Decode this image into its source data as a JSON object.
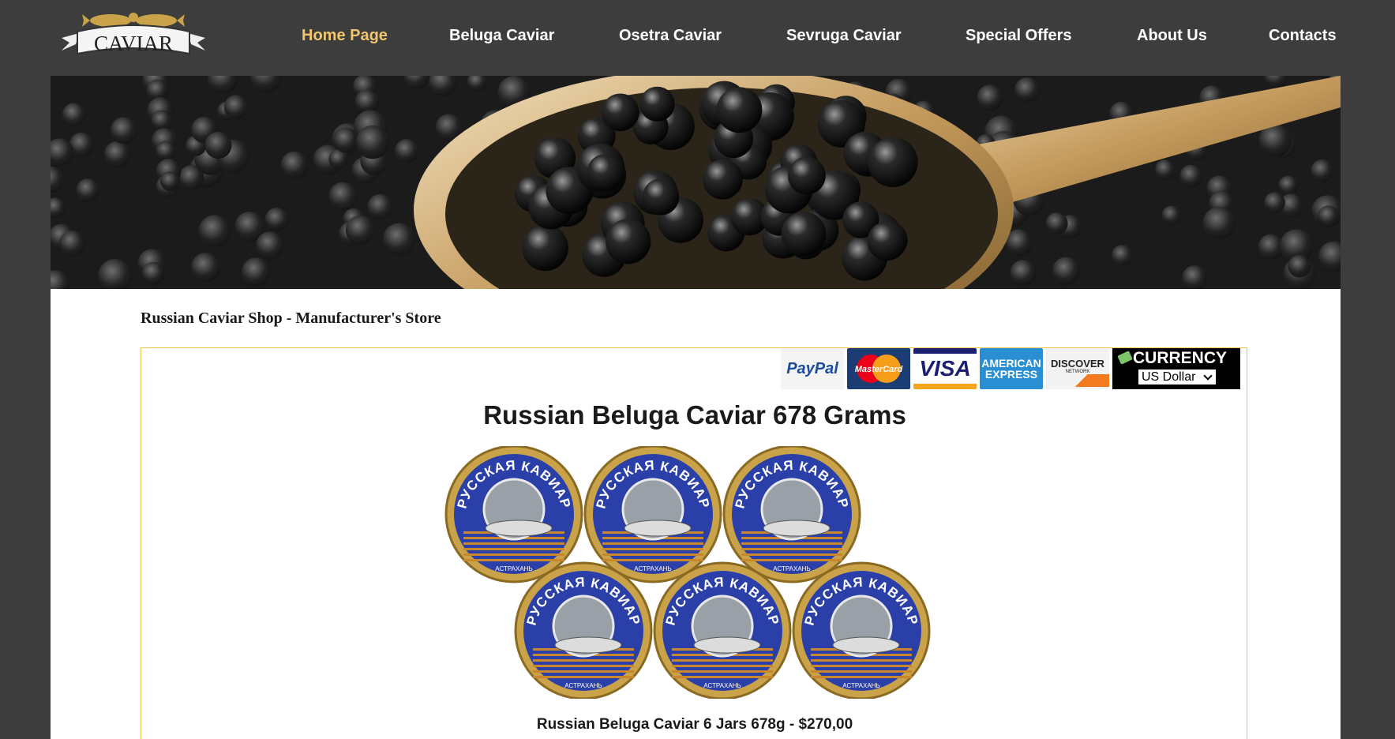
{
  "brand": {
    "logo_text": "CAVIAR"
  },
  "nav": {
    "items": [
      {
        "label": "Home Page",
        "active": true
      },
      {
        "label": "Beluga Caviar",
        "active": false
      },
      {
        "label": "Osetra Caviar",
        "active": false
      },
      {
        "label": "Sevruga Caviar",
        "active": false
      },
      {
        "label": "Special Offers",
        "active": false
      },
      {
        "label": "About Us",
        "active": false
      },
      {
        "label": "Contacts",
        "active": false
      }
    ]
  },
  "page": {
    "store_title": "Russian Caviar Shop - Manufacturer's Store"
  },
  "payments": {
    "paypal": "PayPal",
    "mastercard": "MasterCard",
    "visa": "VISA",
    "amex_line1": "AMERICAN",
    "amex_line2": "EXPRESS",
    "discover": "DISCOVER",
    "discover_sub": "NETWORK"
  },
  "currency": {
    "label": "CURRENCY",
    "selected": "US Dollar"
  },
  "product": {
    "title": "Russian Beluga Caviar 678 Grams",
    "caption": "Russian Beluga Caviar 6 Jars 678g - $270,00",
    "tin_text": "РУССКАЯ КАВИАР",
    "tin_bottom": "АСТРАХАНЬ"
  },
  "colors": {
    "background": "#3d3d3d",
    "nav_active": "#f2c66d",
    "box_border": "#e6c44d",
    "tin_blue": "#2a3fa8",
    "tin_gold": "#c9a24a"
  }
}
